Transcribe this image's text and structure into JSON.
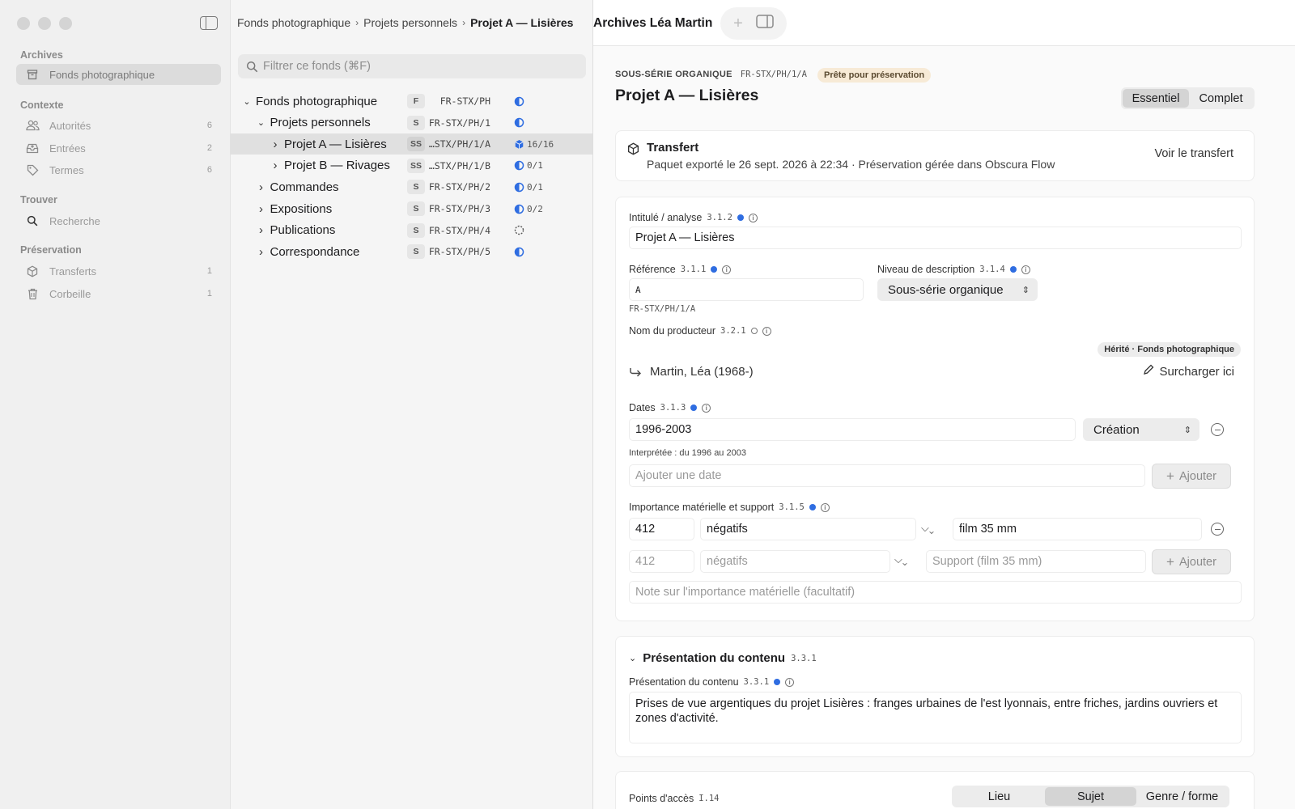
{
  "sidebar": {
    "sections": [
      {
        "title": "Archives",
        "items": [
          {
            "label": "Fonds photographique",
            "icon": "archive-box-icon",
            "count": ""
          }
        ]
      },
      {
        "title": "Contexte",
        "items": [
          {
            "label": "Autorités",
            "icon": "people-icon",
            "count": "6"
          },
          {
            "label": "Entrées",
            "icon": "inbox-icon",
            "count": "2"
          },
          {
            "label": "Termes",
            "icon": "tag-icon",
            "count": "6"
          }
        ]
      },
      {
        "title": "Trouver",
        "items": [
          {
            "label": "Recherche",
            "icon": "search-icon",
            "count": ""
          }
        ]
      },
      {
        "title": "Préservation",
        "items": [
          {
            "label": "Transferts",
            "icon": "package-icon",
            "count": "1"
          },
          {
            "label": "Corbeille",
            "icon": "trash-icon",
            "count": "1"
          }
        ]
      }
    ]
  },
  "breadcrumb": [
    "Fonds photographique",
    "Projets personnels",
    "Projet A — Lisières"
  ],
  "filter": {
    "placeholder": "Filtrer ce fonds (⌘F)"
  },
  "tree": [
    {
      "label": "Fonds photographique",
      "level": "F",
      "ref": "FR-STX/PH",
      "progress": "",
      "status": "half",
      "expanded": true,
      "depth": 0
    },
    {
      "label": "Projets personnels",
      "level": "S",
      "ref": "FR-STX/PH/1",
      "progress": "",
      "status": "half",
      "expanded": true,
      "depth": 1
    },
    {
      "label": "Projet A — Lisières",
      "level": "SS",
      "ref": "…STX/PH/1/A",
      "progress": "16/16",
      "status": "cube",
      "expanded": false,
      "depth": 2,
      "selected": true
    },
    {
      "label": "Projet B — Rivages",
      "level": "SS",
      "ref": "…STX/PH/1/B",
      "progress": "0/1",
      "status": "half",
      "expanded": false,
      "depth": 2
    },
    {
      "label": "Commandes",
      "level": "S",
      "ref": "FR-STX/PH/2",
      "progress": "0/1",
      "status": "half",
      "expanded": false,
      "depth": 1
    },
    {
      "label": "Expositions",
      "level": "S",
      "ref": "FR-STX/PH/3",
      "progress": "0/2",
      "status": "half",
      "expanded": false,
      "depth": 1
    },
    {
      "label": "Publications",
      "level": "S",
      "ref": "FR-STX/PH/4",
      "progress": "",
      "status": "dashed",
      "expanded": false,
      "depth": 1
    },
    {
      "label": "Correspondance",
      "level": "S",
      "ref": "FR-STX/PH/5",
      "progress": "",
      "status": "half",
      "expanded": false,
      "depth": 1
    }
  ],
  "window": {
    "title": "Archives Léa Martin"
  },
  "record": {
    "kicker": "SOUS-SÉRIE ORGANIQUE",
    "kicker_ref": "FR-STX/PH/1/A",
    "badge": "Prête pour préservation",
    "title": "Projet A — Lisières",
    "modes": [
      "Essentiel",
      "Complet"
    ]
  },
  "transfer": {
    "title": "Transfert",
    "text": "Paquet exporté le 26 sept. 2026 à 22:34 · Préservation gérée dans Obscura Flow",
    "action": "Voir le transfert"
  },
  "fields": {
    "intitule": {
      "label": "Intitulé / analyse",
      "code": "3.1.2",
      "value": "Projet A — Lisières"
    },
    "reference": {
      "label": "Référence",
      "code": "3.1.1",
      "value": "A",
      "full": "FR-STX/PH/1/A"
    },
    "niveau": {
      "label": "Niveau de description",
      "code": "3.1.4",
      "value": "Sous-série organique"
    },
    "producteur": {
      "label": "Nom du producteur",
      "code": "3.2.1",
      "inherited": "Hérité · Fonds photographique",
      "value": "Martin, Léa (1968-)",
      "override": "Surcharger ici"
    },
    "dates": {
      "label": "Dates",
      "code": "3.1.3",
      "value": "1996-2003",
      "type": "Création",
      "interpreted": "Interprétée : du 1996 au 2003",
      "add_placeholder": "Ajouter une date",
      "add_label": "Ajouter"
    },
    "importance": {
      "label": "Importance matérielle et support",
      "code": "3.1.5",
      "count": "412",
      "unit": "négatifs",
      "support": "film 35 mm",
      "count_placeholder": "412",
      "unit_placeholder": "négatifs",
      "support_placeholder": "Support (film 35 mm)",
      "add_label": "Ajouter",
      "note_placeholder": "Note sur l'importance matérielle (facultatif)"
    }
  },
  "presentation": {
    "section_title": "Présentation du contenu",
    "section_code": "3.3.1",
    "label": "Présentation du contenu",
    "code": "3.3.1",
    "value": "Prises de vue argentiques du projet Lisières : franges urbaines de l'est lyonnais, entre friches, jardins ouvriers et zones d'activité."
  },
  "access_points": {
    "label": "Points d'accès",
    "code": "I.14",
    "tabs": [
      "Lieu",
      "Sujet",
      "Genre / forme"
    ]
  }
}
